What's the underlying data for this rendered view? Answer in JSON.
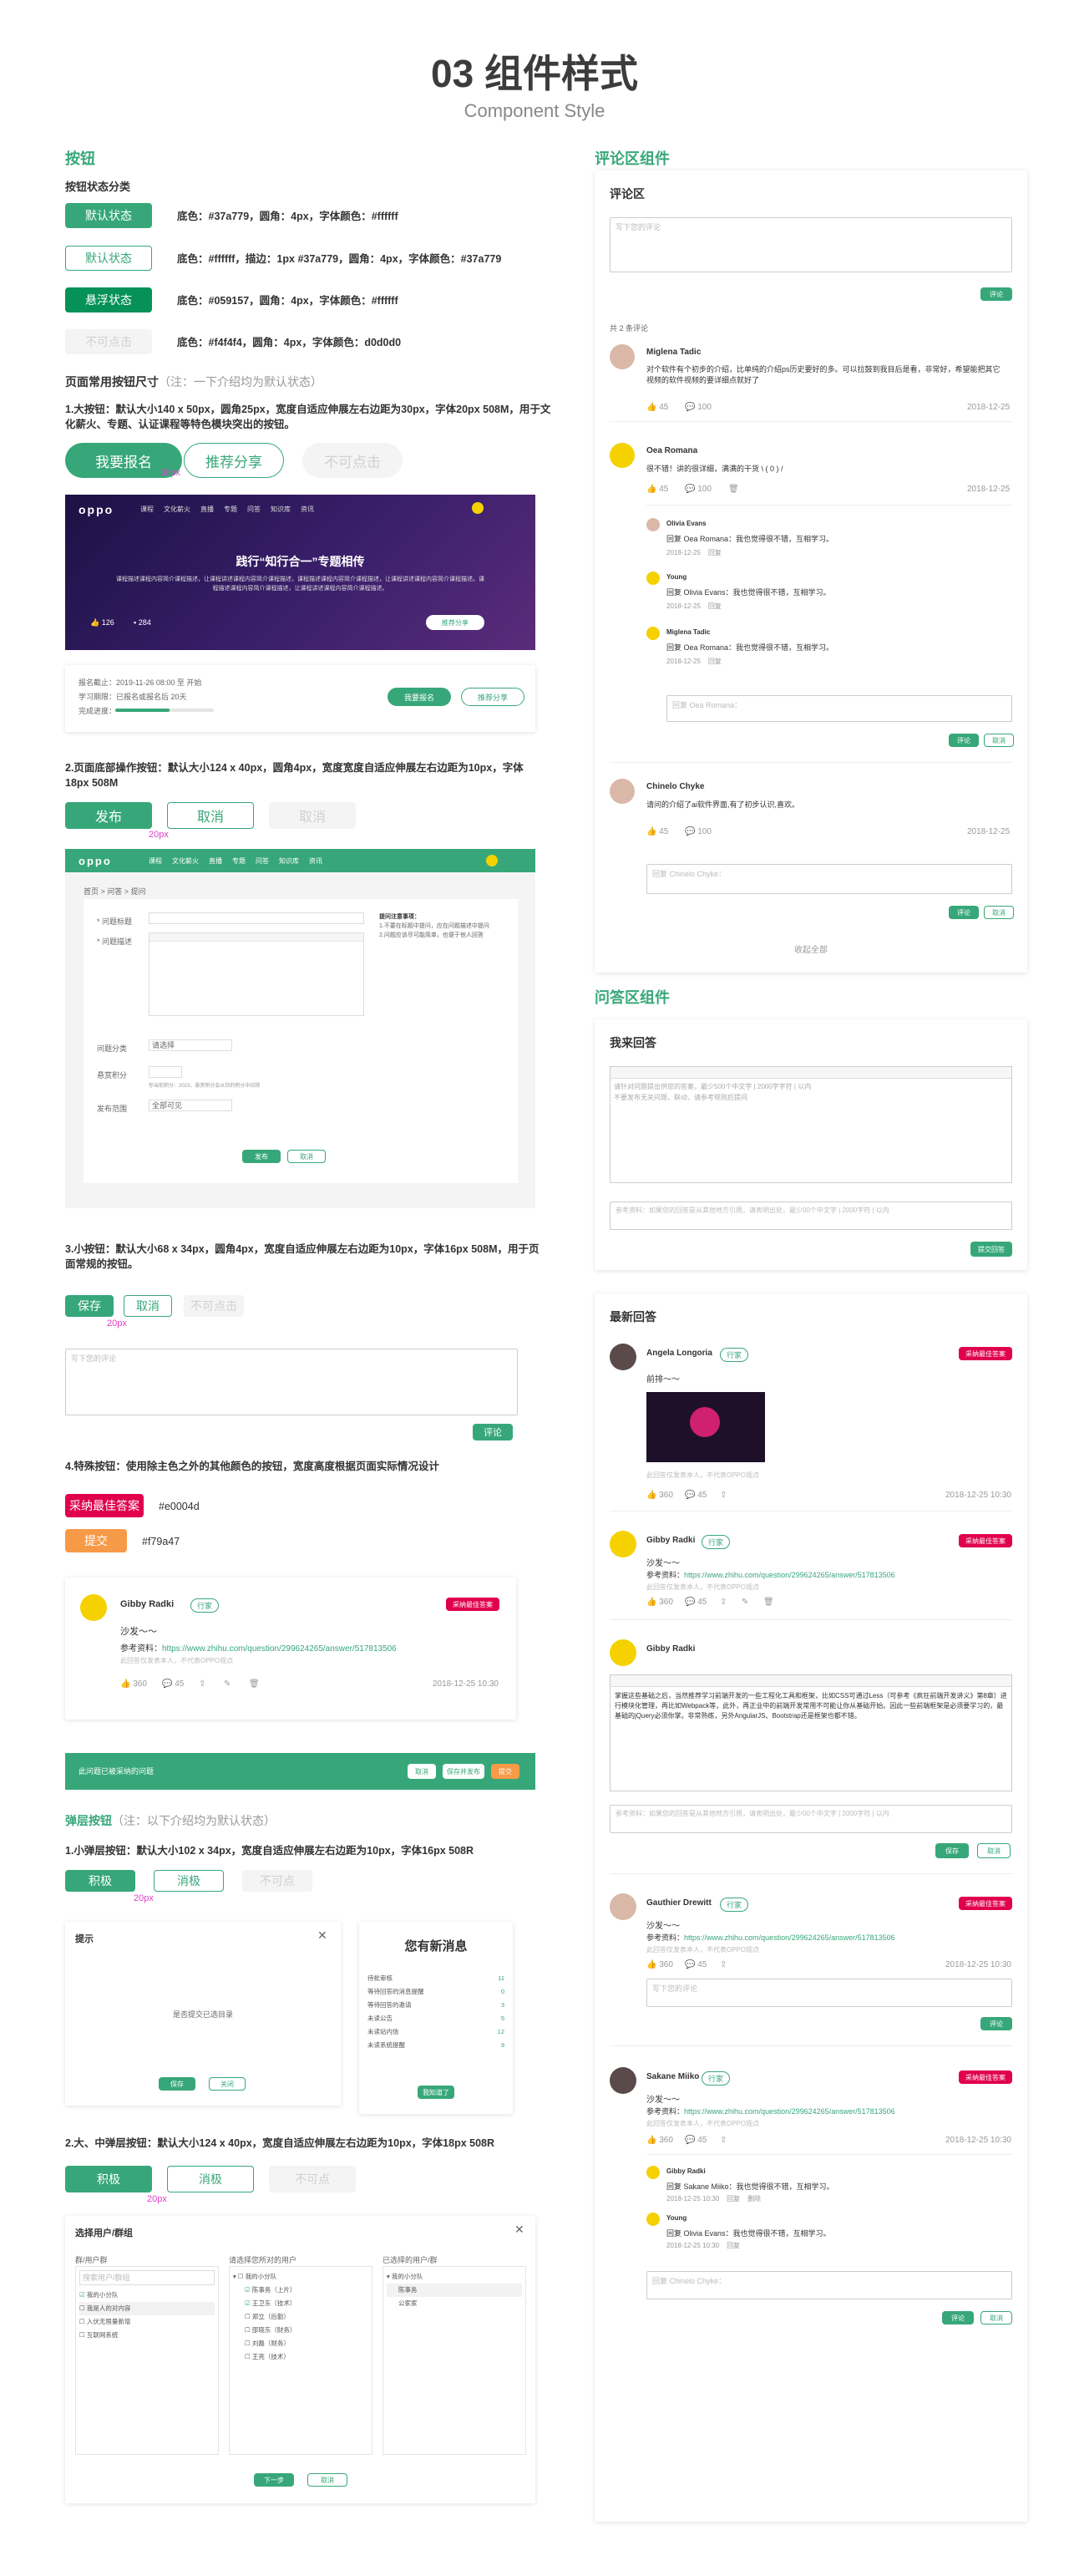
{
  "header": {
    "title": "03 组件样式",
    "subtitle": "Component Style"
  },
  "left": {
    "buttons_title": "按钮",
    "states_title": "按钮状态分类",
    "states": [
      {
        "label": "默认状态",
        "desc": "底色：#37a779，圆角：4px，字体颜色：#ffffff"
      },
      {
        "label": "默认状态",
        "desc": "底色：#ffffff，描边：1px #37a779，圆角：4px，字体颜色：#37a779"
      },
      {
        "label": "悬浮状态",
        "desc": "底色：#059157，圆角：4px，字体颜色：#ffffff"
      },
      {
        "label": "不可点击",
        "desc": "底色：#f4f4f4，圆角：4px，字体颜色：d0d0d0"
      }
    ],
    "sizes_title": "页面常用按钮尺寸",
    "sizes_note": "（注：一下介绍均为默认状态）",
    "large_desc": "1.大按钮：默认大小140 x 50px，圆角25px，宽度自适应伸展左右边距为30px，字体20px 508M，用于文化薪火、专题、认证课程等特色模块突出的按钮。",
    "large_buttons": [
      "我要报名",
      "推荐分享",
      "不可点击"
    ],
    "dim_30": "30px",
    "banner": {
      "logo": "oppo",
      "nav": [
        "课程",
        "文化薪火",
        "直播",
        "专题",
        "问答",
        "知识库",
        "资讯"
      ],
      "title": "践行“知行合一”专题相传",
      "body": "课程描述课程内容简介课程描述，让课程讲述课程内容简介课程描述，课程描述课程内容简介课程描述，让课程讲述课程内容简介课程描述。课程描述课程内容简介课程描述，让课程讲述课程内容简介课程描述。",
      "likes": "126",
      "comments": "284",
      "share": "推荐分享"
    },
    "course_card": {
      "l1": "报名截止：2019-11-26 08:00 至 开始",
      "l2": "学习期限：已报名或报名后 20天",
      "l3": "完成进度：",
      "b1": "我要报名",
      "b2": "推荐分享"
    },
    "bottom_desc": "2.页面底部操作按钮：默认大小124 x 40px，圆角4px，宽度宽度自适应伸展左右边距为10px，字体18px 508M",
    "bottom_buttons": [
      "发布",
      "取消",
      "取消"
    ],
    "dim_20": "20px",
    "form": {
      "crumb": "首页 > 问答 > 提问",
      "title_label": "* 问题标题",
      "desc_label": "* 问题描述",
      "tip_title": "提问注意事项：",
      "tip1": "1.不要在标题中提问，应在问题描述中提问",
      "tip2": "2.问题应该尽可能简单，也便于他人回答",
      "cat_label": "问题分类",
      "cat_value": "请选择",
      "reward_label": "悬赏积分",
      "reward_hint": "你当前积分：2023，悬赏积分会从你的积分中扣除",
      "anon_label": "发布范围",
      "anon_value": "全部可见",
      "publish": "发布",
      "cancel": "取消"
    },
    "small_desc": "3.小按钮：默认大小68 x 34px，圆角4px，宽度自适应伸展左右边距为10px，字体16px 508M，用于页面常规的按钮。",
    "small_buttons": [
      "保存",
      "取消",
      "不可点击"
    ],
    "comment_placeholder": "写下您的评论",
    "comment_submit": "评论",
    "special_desc": "4.特殊按钮：使用除主色之外的其他颜色的按钮，宽度高度根据页面实际情况设计",
    "special": [
      {
        "label": "采纳最佳答案",
        "color": "#e0004d"
      },
      {
        "label": "提交",
        "color": "#f79a47"
      }
    ],
    "answer_card": {
      "name": "Gibby Radki",
      "tag": "行家",
      "best": "采纳最佳答案",
      "text": "沙发～～",
      "ref_label": "参考资料：",
      "ref": "https://www.zhihu.com/question/299624265/answer/517813506",
      "private": "此回答仅发表本人，不代表OPPO观点",
      "likes": "360",
      "comments": "45",
      "time": "2018-12-25 10:30"
    },
    "banner_bar": {
      "text": "此问题已被采纳的问题",
      "b1": "取消",
      "b2": "保存并发布",
      "b3": "提交"
    },
    "popup_title": "弹层按钮",
    "popup_note": "（注：以下介绍均为默认状态）",
    "popup_small_desc": "1.小弹层按钮：默认大小102 x 34px，宽度自适应伸展左右边距为10px，字体16px 508R",
    "popup_small_buttons": [
      "积极",
      "消极",
      "不可点"
    ],
    "dialog": {
      "title": "提示",
      "msg": "是否提交已选目录",
      "ok": "保存",
      "cancel": "关闭"
    },
    "news": {
      "title": "您有新消息",
      "items": [
        {
          "k": "待批审核",
          "v": "11"
        },
        {
          "k": "等待回答的消息提醒",
          "v": "0"
        },
        {
          "k": "等待回答的邀请",
          "v": "3"
        },
        {
          "k": "未读公告",
          "v": "5"
        },
        {
          "k": "未读站内信",
          "v": "12"
        },
        {
          "k": "未读系统提醒",
          "v": "9"
        }
      ],
      "btn": "我知道了"
    },
    "popup_big_desc": "2.大、中弹层按钮：默认大小124 x 40px，宽度自适应伸展左右边距为10px，字体18px 508R",
    "popup_big_buttons": [
      "积极",
      "消极",
      "不可点"
    ],
    "picker": {
      "title": "选择用户/群组",
      "col1": "群/用户群",
      "col1_search": "搜索用户/群组",
      "col1_items": [
        "我的小分队",
        "我是人的对内容",
        "入伏无限量新增",
        "互联网系统"
      ],
      "col2": "请选择您所对的用户",
      "col2_items": [
        "我的小分队",
        "陈事务（上片）",
        "王卫东（技术）",
        "郑立（后勤）",
        "邵晓东（财务）",
        "刘磊（财务）",
        "王亮（技术）"
      ],
      "col3": "已选择的用户/群",
      "col3_items": [
        "我的小分队",
        "陈事务",
        "公家家"
      ],
      "next": "下一步",
      "cancel": "取消"
    }
  },
  "right": {
    "comment_title": "评论区组件",
    "comments": {
      "panel_title": "评论区",
      "placeholder": "写下您的评论",
      "submit": "评论",
      "count": "共 2 条评论",
      "items": [
        {
          "name": "Miglena Tadic",
          "text": "对个软件有个初步的介绍，比单纯的介绍ps历史要好的多。可以拉鼓到我目后是看，非常好，希望能把其它视频的软件视频的要详细点就好了",
          "likes": "45",
          "comments": "100",
          "time": "2018-12-25"
        },
        {
          "name": "Oea Romana",
          "text": "很不错！讲的很详细，满满的干货 \\ ( 0 ) /",
          "likes": "45",
          "comments": "100",
          "time": "2018-12-25"
        }
      ],
      "replies": [
        {
          "name": "Olivia Evans",
          "text": "回复 Oea Romana：我也觉得很不错，互相学习。",
          "time": "2018-12-25",
          "act": "回复"
        },
        {
          "name": "Young",
          "text": "回复 Olivia Evans：我也觉得很不错，互相学习。",
          "time": "2018-12-25",
          "act": "回复"
        },
        {
          "name": "Miglena Tadic",
          "text": "回复 Oea Romana：我也觉得很不错，互相学习。",
          "time": "2018-12-25",
          "act": "回复"
        }
      ],
      "reply_placeholder": "回复 Oea Romana：",
      "reply_submit": "评论",
      "reply_cancel": "取消",
      "third": {
        "name": "Chinelo Chyke",
        "text": "请问的介绍了ai软件界面,有了初步认识,喜欢。",
        "likes": "45",
        "comments": "100",
        "time": "2018-12-25"
      },
      "third_placeholder": "回复 Chinelo Chyke：",
      "collapse": "收起全部"
    },
    "qa_title": "问答区组件",
    "my_answer": {
      "title": "我来回答",
      "editor_ph1": "请针对问题提出供您的答案，最少500个中文字 | 2000字字符 | 以内",
      "editor_ph2": "不要发布无关问题，联动，请参考规则后提问",
      "ref_ph": "参考资料：如果您的回答是从其他地方引用，请表明出处，最少00个中文字 | 2000字符 | 以内",
      "submit": "提交回答"
    },
    "latest": {
      "title": "最新回答",
      "items": [
        {
          "name": "Angela Longoria",
          "tag": "行家",
          "best": "采纳最佳答案",
          "text": "前排～～",
          "private": "此回答仅发表本人，不代表OPPO观点",
          "likes": "360",
          "comments": "45",
          "time": "2018-12-25 10:30"
        },
        {
          "name": "Gibby Radki",
          "tag": "行家",
          "best": "采纳最佳答案",
          "text": "沙发～～",
          "ref_label": "参考资料：",
          "ref": "https://www.zhihu.com/question/299624265/answer/517813506",
          "private": "此回答仅发表本人，不代表OPPO观点",
          "likes": "360",
          "comments": "45",
          "time": "2018-12-25 10:30"
        }
      ],
      "edit": {
        "name": "Gibby Radki",
        "body": "掌握这些基础之后，当然推荐学习前端开发的一些工程化工具和框架，比如CSS可通过Less（可参考《疯狂前端开发讲义》第8章）进行模块化管理，再比如Webpack等，此外，再正业中的前端开发常用不可能让你从基础开始。因此一些前端框架是必须要学习的，最基础的jQuery必须你掌。非常熟练，另外AngularJS、Bootstrap还是框架也都不错。",
        "ref_ph": "参考资料：如果您的回答是从其他地方引用，请表明出处，最少00个中文字 | 2000字符 | 以内",
        "save": "保存",
        "cancel": "取消"
      },
      "item3": {
        "name": "Gauthier Drewitt",
        "tag": "行家",
        "best": "采纳最佳答案",
        "text": "沙发～～",
        "ref_label": "参考资料：",
        "ref": "https://www.zhihu.com/question/299624265/answer/517813506",
        "private": "此回答仅发表本人，不代表OPPO观点",
        "likes": "360",
        "comments": "45",
        "time": "2018-12-25 10:30",
        "ph": "写下您的评论",
        "btn": "评论"
      },
      "item4": {
        "name": "Sakane Miiko",
        "tag": "行家",
        "best": "采纳最佳答案",
        "text": "沙发～～",
        "ref_label": "参考资料：",
        "ref": "https://www.zhihu.com/question/299624265/answer/517813506",
        "private": "此回答仅发表本人，不代表OPPO观点",
        "likes": "360",
        "comments": "45",
        "time": "2018-12-25 10:30"
      },
      "subreplies": [
        {
          "name": "Gibby Radki",
          "text": "回复 Sakane Miiko：我也觉得很不错，互相学习。",
          "time": "2018-12-25 10:30",
          "a1": "回复",
          "a2": "删除"
        },
        {
          "name": "Young",
          "text": "回复 Olivia Evans：我也觉得很不错，互相学习。",
          "time": "2018-12-25 10:30",
          "a1": "回复"
        }
      ],
      "last_ph": "回复 Chinelo Chyke：",
      "last_submit": "评论",
      "last_cancel": "取消"
    }
  },
  "colors": {
    "primary": "#37a779",
    "hover": "#059157",
    "disabled_bg": "#f4f4f4",
    "disabled_fg": "#d0d0d0",
    "red": "#e0004d",
    "orange": "#f79a47",
    "dim": "#e040c8"
  }
}
